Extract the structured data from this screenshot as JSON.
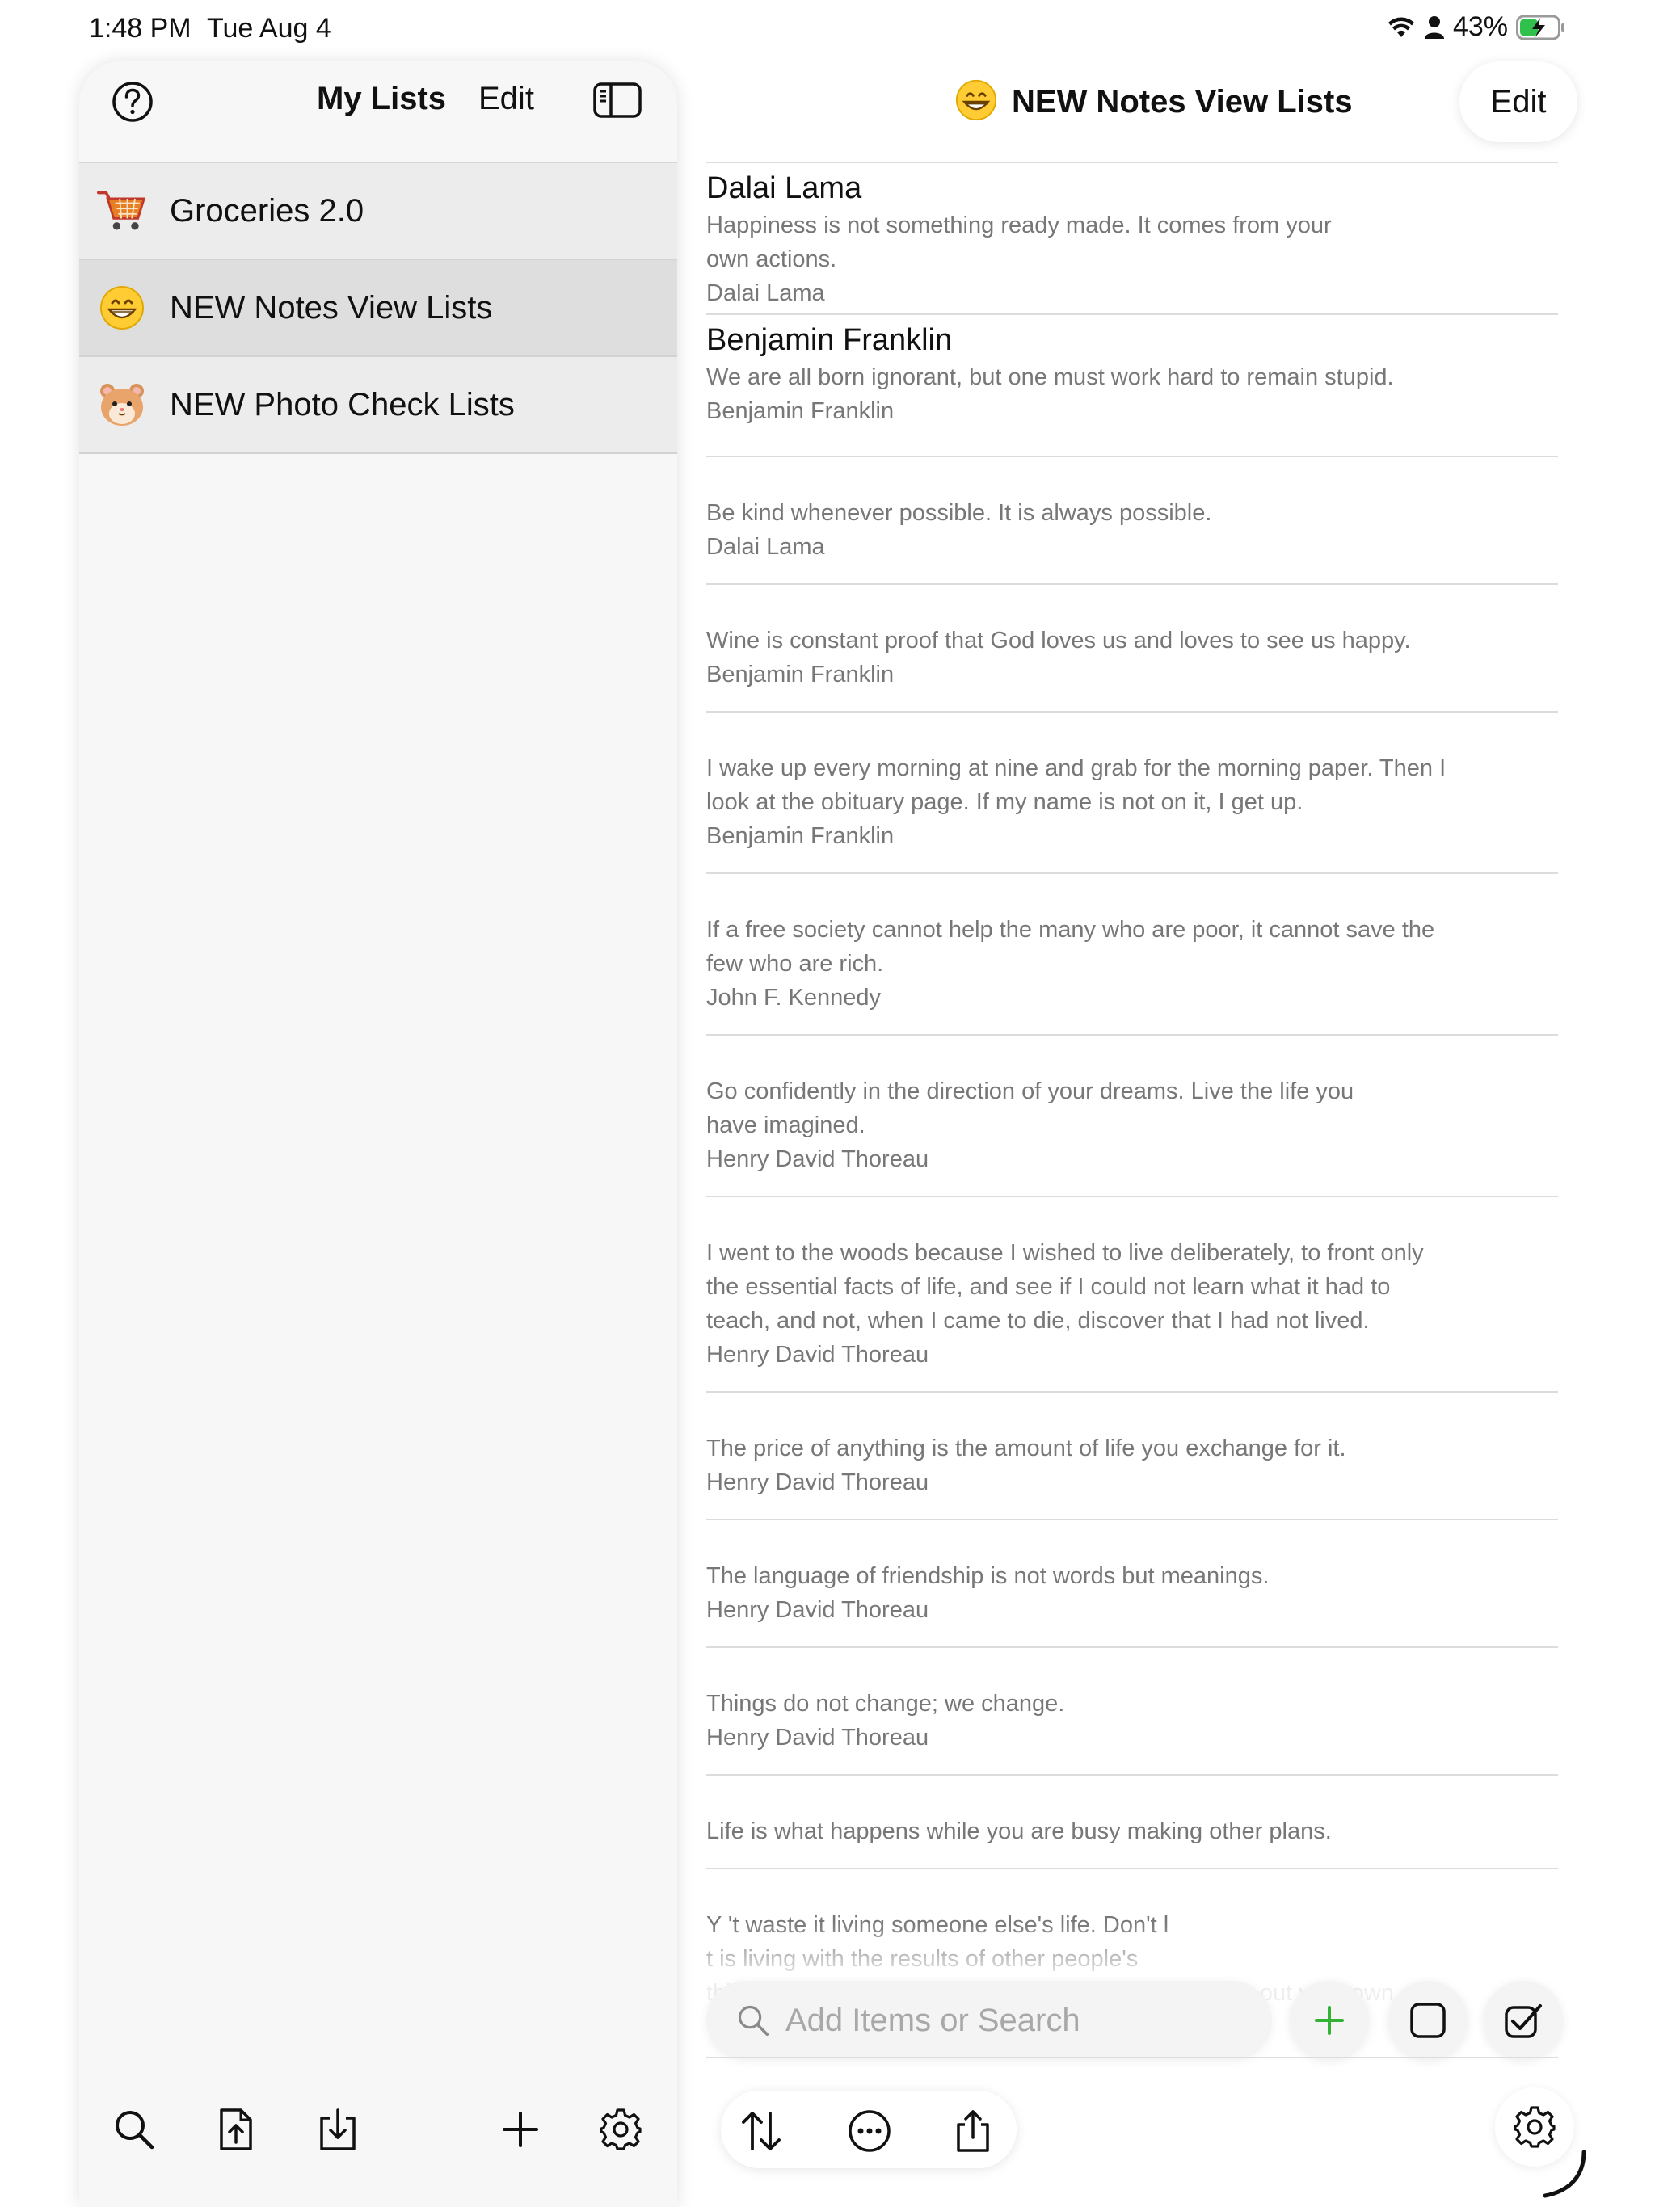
{
  "status_bar": {
    "time": "1:48 PM",
    "date": "Tue Aug 4",
    "battery": "43%",
    "icons": [
      "wifi-icon",
      "person-icon",
      "battery-charging-icon"
    ]
  },
  "sidebar": {
    "title": "My Lists",
    "edit_label": "Edit",
    "items": [
      {
        "label": "Groceries 2.0",
        "icon": "shopping-cart-icon",
        "selected": false
      },
      {
        "label": "NEW Notes View Lists",
        "icon": "grinning-face-icon",
        "selected": true
      },
      {
        "label": "NEW Photo Check Lists",
        "icon": "hamster-icon",
        "selected": false
      }
    ]
  },
  "detail": {
    "title": "NEW Notes View Lists",
    "edit_label": "Edit",
    "notes": [
      {
        "title": "Dalai Lama",
        "body": [
          "Happiness is not something ready made. It comes from your",
          "own actions."
        ],
        "author": "Dalai Lama"
      },
      {
        "title": "Benjamin Franklin",
        "body": [
          "We are all born ignorant, but one must work hard to remain stupid."
        ],
        "author": "Benjamin Franklin"
      },
      {
        "title": "",
        "body": [
          "Be kind whenever possible. It is always possible."
        ],
        "author": "Dalai Lama"
      },
      {
        "title": "",
        "body": [
          "Wine is constant proof that God loves us and loves to see us happy."
        ],
        "author": "Benjamin Franklin"
      },
      {
        "title": "",
        "body": [
          "I wake up every morning at nine and grab for the morning paper. Then I",
          "look at the obituary page. If my name is not on it, I get up."
        ],
        "author": "Benjamin Franklin"
      },
      {
        "title": "",
        "body": [
          "If a free society cannot help the many who are poor, it cannot save the",
          "few who are rich."
        ],
        "author": "John F. Kennedy"
      },
      {
        "title": "",
        "body": [
          "Go confidently in the direction of your dreams. Live the life you",
          "have imagined."
        ],
        "author": "Henry David Thoreau"
      },
      {
        "title": "",
        "body": [
          "I went to the woods because I wished to live deliberately, to front only",
          "the essential facts of life, and see if I could not learn what it had to",
          "teach, and not, when I came to die, discover that I had not lived."
        ],
        "author": "Henry David Thoreau"
      },
      {
        "title": "",
        "body": [
          "The price of anything is the amount of life you exchange for it."
        ],
        "author": "Henry David Thoreau"
      },
      {
        "title": "",
        "body": [
          "The language of friendship is not words but meanings."
        ],
        "author": "Henry David Thoreau"
      },
      {
        "title": "",
        "body": [
          "Things do not change; we change."
        ],
        "author": "Henry David Thoreau"
      },
      {
        "title": "",
        "body": [
          "Life is what happens while you are busy making other plans."
        ],
        "author": ""
      },
      {
        "title": "",
        "body": [
          "Y                                        't waste it living someone else's life. Don't l",
          "t                                    is living with the results of other people's",
          "thinking. Don't let the noise of others' opinions drown out your own"
        ],
        "author": ""
      }
    ]
  },
  "search": {
    "placeholder": "Add Items or Search"
  },
  "colors": {
    "accent_green": "#34b233",
    "battery_green": "#30c04c",
    "sidebar_bg": "#f7f7f7",
    "row_bg": "#ececec",
    "selected_row_bg": "#dedede"
  }
}
